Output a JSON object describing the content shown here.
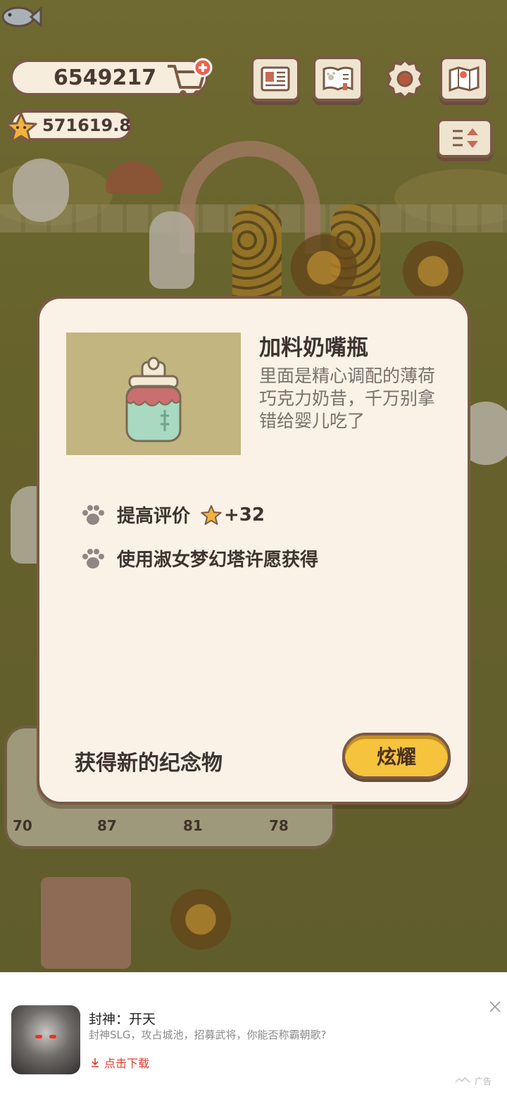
{
  "hud": {
    "fish_count": "6549217",
    "star_count": "571619.8",
    "icons": [
      "fish-icon",
      "cart-add-icon",
      "star-icon",
      "newspaper-icon",
      "paw-book-icon",
      "settings-gear-icon",
      "map-icon",
      "sort-toggle-icon"
    ]
  },
  "modal": {
    "item_name": "加料奶嘴瓶",
    "item_description": "里面是精心调配的薄荷巧克力奶昔，千万别拿错给婴儿吃了",
    "effects": [
      {
        "text": "提高评价",
        "star_value": "+32"
      },
      {
        "text": "使用淑女梦幻塔许愿获得"
      }
    ],
    "footer_label": "获得新的纪念物",
    "show_button_label": "炫耀"
  },
  "background_counts": [
    "70",
    "87",
    "81",
    "78"
  ],
  "ad": {
    "title": "封神：开天",
    "subtitle": "封神SLG，攻占城池，招募武将，你能否称霸朝歌?",
    "download_label": "点击下载",
    "tag": "广告"
  },
  "colors": {
    "background": "#7f7a38",
    "panel": "#fbf2e7",
    "border": "#7b5a45",
    "button": "#f5c33c",
    "ad_download": "#e23d30"
  }
}
